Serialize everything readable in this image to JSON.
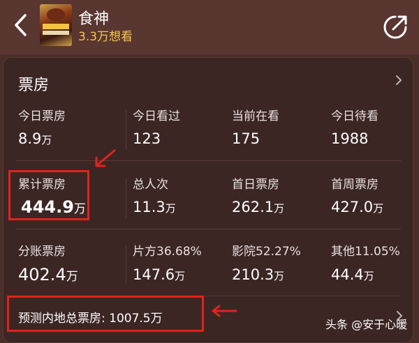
{
  "header": {
    "title": "食神",
    "subtitle": "3.3万想看"
  },
  "card": {
    "title": "票房",
    "rows": [
      [
        {
          "label": "今日票房",
          "num": "8.9",
          "unit": "万"
        },
        {
          "label": "今日看过",
          "num": "123",
          "unit": ""
        },
        {
          "label": "当前在看",
          "num": "175",
          "unit": ""
        },
        {
          "label": "今日待看",
          "num": "1988",
          "unit": ""
        }
      ],
      [
        {
          "label": "累计票房",
          "num": "444.9",
          "unit": "万"
        },
        {
          "label": "总人次",
          "num": "11.3",
          "unit": "万"
        },
        {
          "label": "首日票房",
          "num": "262.1",
          "unit": "万"
        },
        {
          "label": "首周票房",
          "num": "427.0",
          "unit": "万"
        }
      ],
      [
        {
          "label": "分账票房",
          "num": "402.4",
          "unit": "万"
        },
        {
          "label": "片方36.68%",
          "num": "147.6",
          "unit": "万"
        },
        {
          "label": "影院52.27%",
          "num": "210.3",
          "unit": "万"
        },
        {
          "label": "其他11.05%",
          "num": "44.4",
          "unit": "万"
        }
      ]
    ],
    "forecast": {
      "label": "预测内地总票房:",
      "num": "1007.5",
      "unit": "万"
    }
  },
  "watermark": "头条 @安于心暖",
  "colors": {
    "background": "#4a2e2a",
    "card": "#3b2624",
    "accent_gold": "#f5c84b",
    "highlight_red": "#e0231b"
  }
}
